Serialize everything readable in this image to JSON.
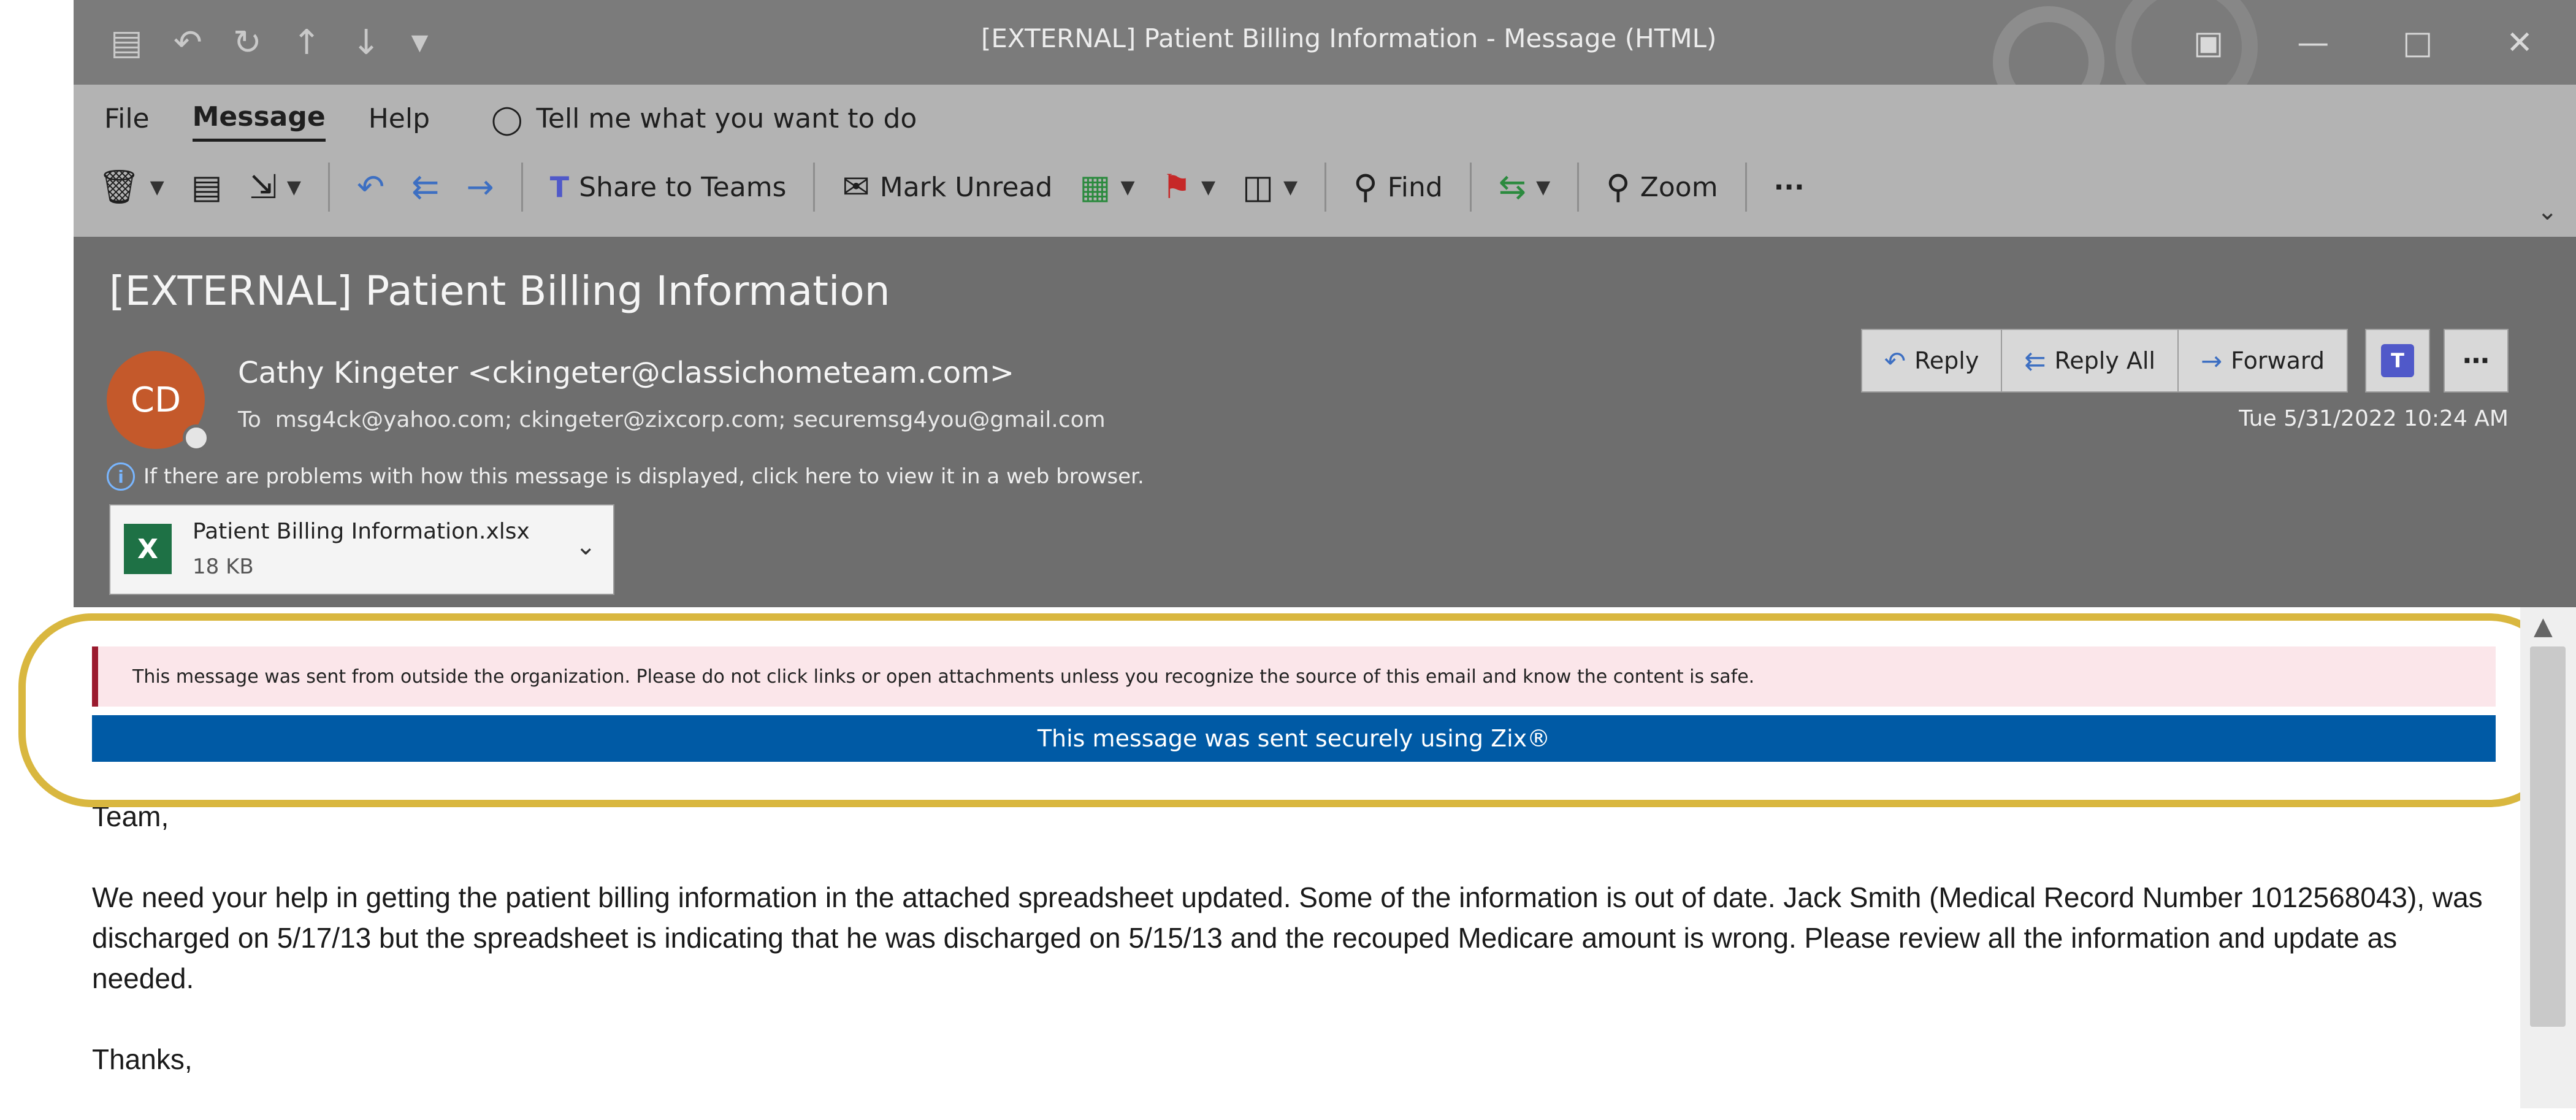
{
  "window": {
    "title": "[EXTERNAL] Patient Billing Information  -  Message (HTML)",
    "qat_icons": [
      "save-icon",
      "undo-icon",
      "redo-icon",
      "up-icon",
      "down-icon",
      "customize-icon"
    ],
    "controls": [
      "restore-icon",
      "minimize-icon",
      "maximize-icon",
      "close-icon"
    ]
  },
  "menu": {
    "items": [
      "File",
      "Message",
      "Help"
    ],
    "active": "Message",
    "tell_me": "Tell me what you want to do"
  },
  "toolbar": {
    "share_to_teams": "Share to Teams",
    "mark_unread": "Mark Unread",
    "find": "Find",
    "zoom": "Zoom",
    "more": "···"
  },
  "message": {
    "subject": "[EXTERNAL] Patient Billing Information",
    "avatar_initials": "CD",
    "sender": "Cathy Kingeter <ckingeter@classichometeam.com>",
    "to_label": "To",
    "to": "msg4ck@yahoo.com; ckingeter@zixcorp.com; securemsg4you@gmail.com",
    "info_notice": "If there are problems with how this message is displayed, click here to view it in a web browser.",
    "date": "Tue 5/31/2022 10:24 AM",
    "attachment": {
      "name": "Patient Billing Information.xlsx",
      "size": "18 KB"
    },
    "actions": {
      "reply": "Reply",
      "reply_all": "Reply All",
      "forward": "Forward"
    }
  },
  "banners": {
    "external_warning": "This message was sent from outside the organization. Please do not click links or open attachments unless you recognize the source of this email and know the content is safe.",
    "zix": "This message was sent securely using Zix®"
  },
  "body": {
    "greeting": "Team,",
    "paragraph": "We need your help in getting the patient billing information in the attached spreadsheet updated. Some of the information is out of date. Jack Smith (Medical Record Number 1012568043), was discharged on 5/17/13 but the spreadsheet is indicating that he was discharged on 5/15/13 and the recouped Medicare amount is wrong. Please review all the information and update as needed.",
    "closing": "Thanks,"
  },
  "colors": {
    "titlebar": "#7b7b7b",
    "ribbon": "#b3b3b3",
    "header": "#6e6e6e",
    "zix_banner": "#005aa5",
    "warning_bar": "#9a1a2e",
    "highlight": "#d9b73f",
    "avatar": "#c4592b"
  }
}
